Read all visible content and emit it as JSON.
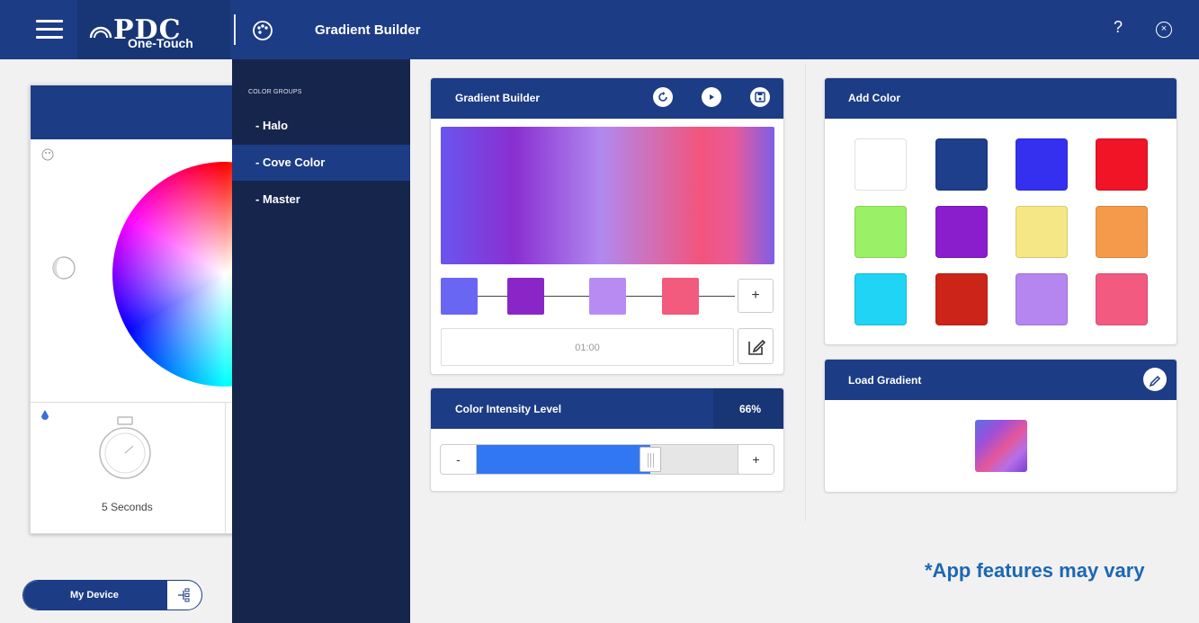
{
  "header": {
    "logo_text": "PDC",
    "title": "Gradient Builder",
    "help_label": "?",
    "close_label": "×"
  },
  "background_app": {
    "card_title": "One-Touch",
    "timer_label": "5 Seconds",
    "my_device_label": "My Device"
  },
  "sidebar": {
    "heading": "COLOR GROUPS",
    "items": [
      {
        "label": "- Halo",
        "active": false
      },
      {
        "label": "- Cove Color",
        "active": true
      },
      {
        "label": "- Master",
        "active": false
      }
    ]
  },
  "gradient_builder": {
    "title": "Gradient Builder",
    "icons": [
      "refresh-icon",
      "play-icon",
      "save-icon"
    ],
    "stops": [
      "#6a66f4",
      "#8a26c8",
      "#b88bf2",
      "#f25a7e"
    ],
    "add_label": "+",
    "duration": "01:00",
    "edit_icon": "edit-icon"
  },
  "intensity": {
    "title": "Color Intensity Level",
    "value_text": "66%",
    "value": 0.66,
    "minus_label": "-",
    "plus_label": "+"
  },
  "add_color": {
    "title": "Add Color",
    "swatches": [
      "#ffffff",
      "#1d3f8c",
      "#3530f0",
      "#f01426",
      "#9af066",
      "#8a1ecc",
      "#f5e686",
      "#f59a4a",
      "#1fd4f4",
      "#cc2418",
      "#b585f0",
      "#f25a80"
    ]
  },
  "load_gradient": {
    "title": "Load Gradient",
    "icon": "pencil-icon"
  },
  "disclaimer": "*App features may vary"
}
